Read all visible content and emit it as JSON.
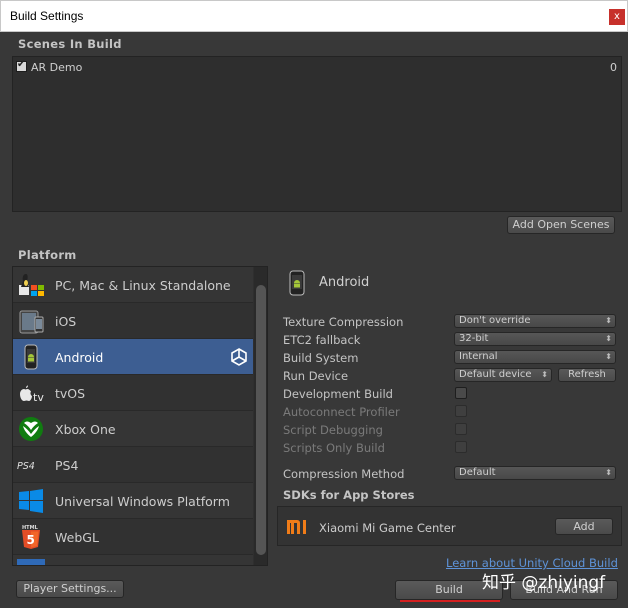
{
  "window": {
    "title": "Build Settings",
    "close_label": "x"
  },
  "scenes": {
    "header": "Scenes In Build",
    "items": [
      {
        "name": "AR Demo",
        "index": "0",
        "checked": true
      }
    ],
    "add_open_scenes_label": "Add Open Scenes"
  },
  "platform": {
    "header": "Platform",
    "items": [
      {
        "label": "PC, Mac & Linux Standalone",
        "icon": "pc-mac-linux-icon"
      },
      {
        "label": "iOS",
        "icon": "ios-device-icon"
      },
      {
        "label": "Android",
        "icon": "android-phone-icon",
        "selected": true
      },
      {
        "label": "tvOS",
        "icon": "apple-tv-icon"
      },
      {
        "label": "Xbox One",
        "icon": "xbox-icon"
      },
      {
        "label": "PS4",
        "icon": "ps4-icon"
      },
      {
        "label": "Universal Windows Platform",
        "icon": "windows-icon"
      },
      {
        "label": "WebGL",
        "icon": "html5-icon"
      }
    ]
  },
  "details": {
    "title": "Android",
    "texture_compression": {
      "label": "Texture Compression",
      "value": "Don't override"
    },
    "etc2_fallback": {
      "label": "ETC2 fallback",
      "value": "32-bit"
    },
    "build_system": {
      "label": "Build System",
      "value": "Internal"
    },
    "run_device": {
      "label": "Run Device",
      "value": "Default device",
      "refresh_label": "Refresh"
    },
    "development_build": {
      "label": "Development Build"
    },
    "autoconnect_profiler": {
      "label": "Autoconnect Profiler"
    },
    "script_debugging": {
      "label": "Script Debugging"
    },
    "scripts_only_build": {
      "label": "Scripts Only Build"
    },
    "compression_method": {
      "label": "Compression Method",
      "value": "Default"
    }
  },
  "sdks": {
    "header": "SDKs for App Stores",
    "items": [
      {
        "label": "Xiaomi Mi Game Center",
        "add_label": "Add"
      }
    ]
  },
  "footer": {
    "cloud_link": "Learn about Unity Cloud Build",
    "player_settings_label": "Player Settings...",
    "build_label": "Build",
    "build_and_run_label": "Build And Run"
  },
  "watermark": "知乎 @zhiyingf",
  "colors": {
    "selected": "#3d5e92",
    "link": "#5e93d8",
    "close": "#c7302b"
  }
}
